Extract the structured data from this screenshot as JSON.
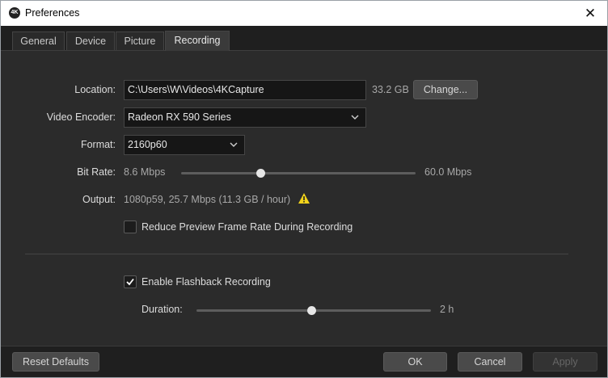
{
  "window": {
    "title": "Preferences",
    "app_icon_text": "4K"
  },
  "tabs": [
    {
      "label": "General"
    },
    {
      "label": "Device"
    },
    {
      "label": "Picture"
    },
    {
      "label": "Recording",
      "active": true
    }
  ],
  "recording": {
    "location": {
      "label": "Location:",
      "value": "C:\\Users\\W\\Videos\\4KCapture",
      "free_space": "33.2 GB",
      "change_label": "Change..."
    },
    "video_encoder": {
      "label": "Video Encoder:",
      "value": "Radeon RX 590 Series"
    },
    "format": {
      "label": "Format:",
      "value": "2160p60"
    },
    "bit_rate": {
      "label": "Bit Rate:",
      "min": "8.6 Mbps",
      "max": "60.0 Mbps",
      "fraction": 0.34
    },
    "output": {
      "label": "Output:",
      "value": "1080p59, 25.7 Mbps (11.3 GB / hour)"
    },
    "reduce_preview": {
      "label": "Reduce Preview Frame Rate During Recording",
      "checked": false
    },
    "flashback": {
      "label": "Enable Flashback Recording",
      "checked": true
    },
    "duration": {
      "label": "Duration:",
      "value": "2 h",
      "fraction": 0.49
    }
  },
  "footer": {
    "reset_label": "Reset Defaults",
    "ok_label": "OK",
    "cancel_label": "Cancel",
    "apply_label": "Apply"
  },
  "colors": {
    "warning": "#f2d31b",
    "background": "#2b2b2b",
    "field": "#161616"
  }
}
